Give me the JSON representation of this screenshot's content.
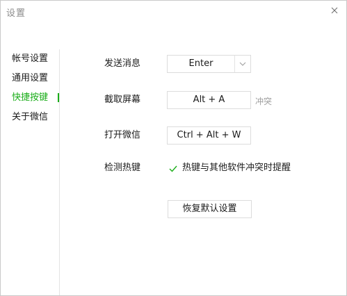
{
  "window": {
    "title": "设置",
    "close_icon": "close-icon"
  },
  "sidebar": {
    "items": [
      {
        "label": "帐号设置",
        "active": false
      },
      {
        "label": "通用设置",
        "active": false
      },
      {
        "label": "快捷按键",
        "active": true
      },
      {
        "label": "关于微信",
        "active": false
      }
    ]
  },
  "shortcuts": {
    "send_message": {
      "label": "发送消息",
      "value": "Enter",
      "arrow_icon": "chevron-down-icon"
    },
    "screenshot": {
      "label": "截取屏幕",
      "value": "Alt + A",
      "status": "冲突"
    },
    "open_wechat": {
      "label": "打开微信",
      "value": "Ctrl + Alt + W"
    },
    "detect_hotkey": {
      "label": "检测热键",
      "checkbox_checked": true,
      "checkbox_label": "热键与其他软件冲突时提醒"
    },
    "reset_label": "恢复默认设置"
  },
  "colors": {
    "accent": "#1aad19",
    "conflict_text": "#a0a0a0",
    "border": "#dcdcdc"
  }
}
